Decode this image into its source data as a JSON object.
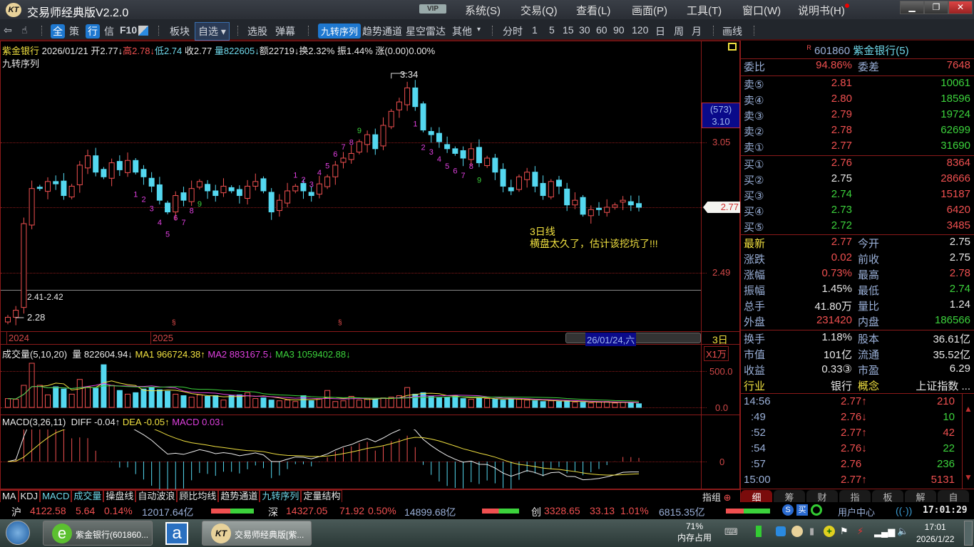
{
  "window": {
    "logo": "KT",
    "title": "交易师经典版V2.2.0",
    "vip": "VIP",
    "menus": [
      "系统(S)",
      "交易(Q)",
      "查看(L)",
      "画面(P)",
      "工具(T)",
      "窗口(W)",
      "说明书(H)"
    ]
  },
  "toolbar": {
    "items": [
      "全",
      "策",
      "行",
      "信",
      "F10",
      "板块",
      "自选",
      "选股",
      "弹幕",
      "九转序列",
      "趋势通道",
      "星空雷达",
      "其他",
      "分时",
      "1",
      "5",
      "15",
      "30",
      "60",
      "90",
      "120",
      "日",
      "周",
      "月",
      "画线"
    ]
  },
  "infoline": {
    "name": "紫金银行",
    "date": "2026/01/21",
    "open": "开2.77↓",
    "high": "高2.78↓",
    "low": "低2.74",
    "close": "收2.77",
    "vol": "量822605↓",
    "amt": "额22719↓",
    "turnover": "换2.32%",
    "amp": "振1.44%",
    "chg": "涨(0.00)0.00%",
    "indicator": "九转序列"
  },
  "chart_labels": {
    "high_label": "3.34",
    "low_label": "2.28",
    "range_label": "2.41-2.42",
    "cursor_count": "(573)",
    "cursor_price": "3.10",
    "last_price_tag": "2.77",
    "note_title": "3日线",
    "note_text": "横盘太久了，估计该挖坑了!!!",
    "years": [
      "2024",
      "2025"
    ],
    "cursor_date": "26/01/24,六",
    "period": "3日",
    "vol_unit": "X1万",
    "div_mark": "§"
  },
  "chart_data": {
    "type": "candlestick",
    "y_ticks": [
      "3.05",
      "2.77",
      "2.49"
    ],
    "ylim": [
      2.2,
      3.4
    ],
    "closes": [
      2.3,
      2.33,
      2.7,
      2.85,
      2.85,
      2.88,
      2.87,
      2.82,
      2.86,
      2.95,
      2.99,
      2.92,
      2.9,
      2.96,
      2.93,
      2.97,
      2.92,
      2.9,
      2.86,
      2.8,
      2.75,
      2.82,
      2.8,
      2.85,
      2.88,
      2.84,
      2.82,
      2.86,
      2.84,
      2.82,
      2.86,
      2.88,
      2.84,
      2.75,
      2.8,
      2.84,
      2.86,
      2.84,
      2.82,
      2.87,
      2.9,
      2.95,
      2.98,
      3.0,
      3.05,
      3.08,
      3.02,
      3.12,
      3.18,
      3.22,
      3.28,
      3.2,
      3.1,
      3.08,
      3.05,
      3.02,
      3.0,
      2.98,
      3.02,
      2.96,
      2.98,
      2.92,
      2.86,
      2.84,
      2.9,
      2.92,
      2.86,
      2.82,
      2.88,
      2.86,
      2.78,
      2.8,
      2.74,
      2.76,
      2.76,
      2.77,
      2.78,
      2.8,
      2.78,
      2.77
    ],
    "volume": {
      "title": "成交量(5,10,20)",
      "vol": "量 822604.94↓",
      "ma1": "MA1 966724.38↑",
      "ma2": "MA2 883167.5↓",
      "ma3": "MA3 1059402.88↓",
      "y_ticks": [
        "500.0",
        "0.0"
      ],
      "ylim": [
        0,
        600
      ],
      "values": [
        120,
        110,
        300,
        600,
        300,
        170,
        280,
        250,
        180,
        380,
        280,
        260,
        580,
        300,
        230,
        180,
        200,
        250,
        270,
        240,
        220,
        180,
        160,
        140,
        170,
        150,
        160,
        100,
        160,
        170,
        200,
        120,
        130,
        100,
        90,
        100,
        80,
        160,
        90,
        120,
        230,
        80,
        90,
        150,
        100,
        120,
        110,
        130,
        140,
        160,
        270,
        180,
        200,
        150,
        130,
        140,
        160,
        120,
        110,
        130,
        120,
        110,
        100,
        120,
        110,
        100,
        90,
        80,
        90,
        80,
        90,
        70,
        70,
        60,
        70,
        80,
        60,
        70,
        60,
        50
      ]
    },
    "macd": {
      "title": "MACD(3,26,11)",
      "diff": "DIFF -0.04↑",
      "dea": "DEA -0.05↑",
      "macd": "MACD 0.03↓",
      "y_ticks": [
        "0"
      ]
    },
    "td_marks": [
      {
        "i": 16,
        "t": "1"
      },
      {
        "i": 17,
        "t": "2"
      },
      {
        "i": 18,
        "t": "3"
      },
      {
        "i": 19,
        "t": "4"
      },
      {
        "i": 20,
        "t": "5"
      },
      {
        "i": 21,
        "t": "6"
      },
      {
        "i": 22,
        "t": "7"
      },
      {
        "i": 23,
        "t": "8"
      },
      {
        "i": 24,
        "t": "9"
      },
      {
        "i": 36,
        "t": "1"
      },
      {
        "i": 37,
        "t": "2"
      },
      {
        "i": 38,
        "t": "3"
      },
      {
        "i": 39,
        "t": "4"
      },
      {
        "i": 40,
        "t": "5"
      },
      {
        "i": 41,
        "t": "6"
      },
      {
        "i": 42,
        "t": "7"
      },
      {
        "i": 43,
        "t": "8"
      },
      {
        "i": 44,
        "t": "9"
      },
      {
        "i": 51,
        "t": "1"
      },
      {
        "i": 52,
        "t": "2"
      },
      {
        "i": 53,
        "t": "3"
      },
      {
        "i": 54,
        "t": "4"
      },
      {
        "i": 55,
        "t": "5"
      },
      {
        "i": 56,
        "t": "6"
      },
      {
        "i": 57,
        "t": "7"
      },
      {
        "i": 58,
        "t": "8"
      },
      {
        "i": 59,
        "t": "9"
      }
    ]
  },
  "bottom_tabs": [
    "MA",
    "KDJ",
    "MACD",
    "成交量",
    "操盘线",
    "自动波浪",
    "顾比均线",
    "趋势通道",
    "九转序列",
    "定量结构"
  ],
  "zhizu": "指组",
  "quote": {
    "code": "601860",
    "name": "紫金银行(5)",
    "r": "R",
    "weibi": {
      "label": "委比",
      "value": "94.86%",
      "label2": "委差",
      "value2": "7648"
    },
    "sells": [
      {
        "l": "卖⑤",
        "p": "2.81",
        "v": "10061"
      },
      {
        "l": "卖④",
        "p": "2.80",
        "v": "18596"
      },
      {
        "l": "卖③",
        "p": "2.79",
        "v": "19724"
      },
      {
        "l": "卖②",
        "p": "2.78",
        "v": "62699"
      },
      {
        "l": "卖①",
        "p": "2.77",
        "v": "31690"
      }
    ],
    "buys": [
      {
        "l": "买①",
        "p": "2.76",
        "v": "8364"
      },
      {
        "l": "买②",
        "p": "2.75",
        "v": "28666"
      },
      {
        "l": "买③",
        "p": "2.74",
        "v": "15187"
      },
      {
        "l": "买④",
        "p": "2.73",
        "v": "6420"
      },
      {
        "l": "买⑤",
        "p": "2.72",
        "v": "3485"
      }
    ],
    "stats": [
      [
        "最新",
        "2.77",
        "今开",
        "2.75"
      ],
      [
        "涨跌",
        "0.02",
        "前收",
        "2.75"
      ],
      [
        "涨幅",
        "0.73%",
        "最高",
        "2.78"
      ],
      [
        "振幅",
        "1.45%",
        "最低",
        "2.74"
      ],
      [
        "总手",
        "41.80万",
        "量比",
        "1.24"
      ],
      [
        "外盘",
        "231420",
        "内盘",
        "186566"
      ]
    ],
    "stats2": [
      [
        "换手",
        "1.18%",
        "股本",
        "36.61亿"
      ],
      [
        "市值",
        "101亿",
        "流通",
        "35.52亿"
      ],
      [
        "收益",
        "0.33③",
        "市盈",
        "6.29"
      ],
      [
        "行业",
        "银行",
        "概念",
        "上证指数 ..."
      ]
    ],
    "ticks": [
      [
        "14:56",
        "2.77↑",
        "210"
      ],
      [
        ":49",
        "2.76↓",
        "10"
      ],
      [
        ":52",
        "2.77↑",
        "42"
      ],
      [
        ":54",
        "2.76↓",
        "22"
      ],
      [
        ":57",
        "2.76",
        "236"
      ],
      [
        "15:00",
        "2.77↑",
        "5131"
      ]
    ],
    "tabs": [
      "细",
      "筹",
      "财",
      "指",
      "板",
      "解",
      "自"
    ]
  },
  "status": {
    "sh": [
      "沪",
      "4122.58",
      "5.64",
      "0.14%",
      "12017.64亿"
    ],
    "sz": [
      "深",
      "14327.05",
      "71.92",
      "0.50%",
      "14899.68亿"
    ],
    "cy": [
      "创",
      "3328.65",
      "33.13",
      "1.01%",
      "6815.35亿"
    ],
    "user_center": "用户中心",
    "clock": "17:01:29"
  },
  "taskbar": {
    "tasks": [
      "紫金银行(601860...",
      "交易师经典版[紫..."
    ],
    "mem_pct": "71%",
    "mem_label": "内存占用",
    "time": "17:01",
    "date": "2026/1/22"
  }
}
